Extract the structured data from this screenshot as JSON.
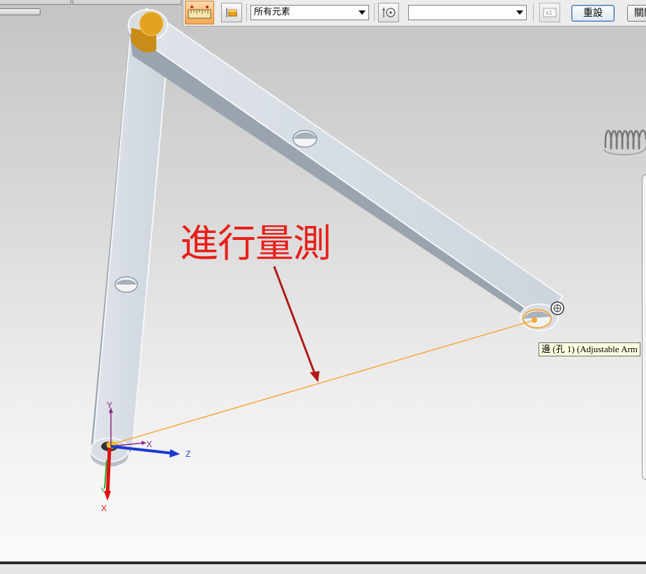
{
  "toolbar": {
    "filter_value": "所有元素",
    "second_value": "",
    "reset_label": "重設",
    "close_label": "關閉",
    "icons": [
      "measure-ruler-icon",
      "part-select-icon",
      "hole-center-icon",
      "distance-field-icon"
    ]
  },
  "viewport": {
    "annotation_text": "進行量測",
    "tooltip_text": "邊 (孔 1) (Adjustable Arm",
    "axis_labels": {
      "x": "X",
      "y": "Y",
      "z": "Z",
      "x_red": "X",
      "y_green": "Y"
    }
  },
  "colors": {
    "annotation": "#e8201a",
    "measure_line": "#f7a838",
    "axis_x": "#e01010",
    "axis_y": "#8a2a8a",
    "axis_z": "#1a3ad0",
    "pin": "#e0a020"
  }
}
